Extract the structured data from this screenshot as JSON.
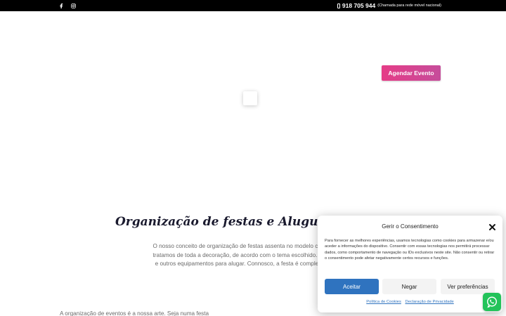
{
  "topbar": {
    "social": [
      {
        "icon": "facebook-icon"
      },
      {
        "icon": "instagram-icon"
      }
    ],
    "phone_number": "918 705 944",
    "phone_note": "(Chamada para rede móvel nacional)"
  },
  "header": {
    "cta_label": "Agendar Evento"
  },
  "main": {
    "heading": "Organização de festas e Aluguer de E",
    "intro_lines": [
      "O nosso conceito de organização de festas assenta no modelo chave na m",
      "tratamos de toda a decoração, de acordo com o tema escolhido. Temos dis",
      "e outros equipamentos para alugar. Connosco, a festa é completa e nenh"
    ],
    "bottom_text": "A organização de eventos é a nossa arte. Seja numa festa"
  },
  "cookie_banner": {
    "title": "Gerir o Consentimento",
    "description": "Para fornecer as melhores experiências, usamos tecnologias como cookies para armazenar e/ou aceder a informações do dispositivo. Consentir com essas tecnologias nos permitirá processar dados, como comportamento de navegação ou IDs exclusivos neste site. Não consentir ou retirar o consentimento pode afetar negativamente certos recursos e funções.",
    "accept_label": "Aceitar",
    "deny_label": "Negar",
    "prefs_label": "Ver preferências",
    "links": [
      "Política de Cookies",
      "Declaração de Privacidade"
    ]
  },
  "colors": {
    "accent_gradient_start": "#e53c87",
    "accent_gradient_end": "#c64d9b",
    "accept_blue": "#2f73bf",
    "whatsapp_green": "#23c35a"
  }
}
